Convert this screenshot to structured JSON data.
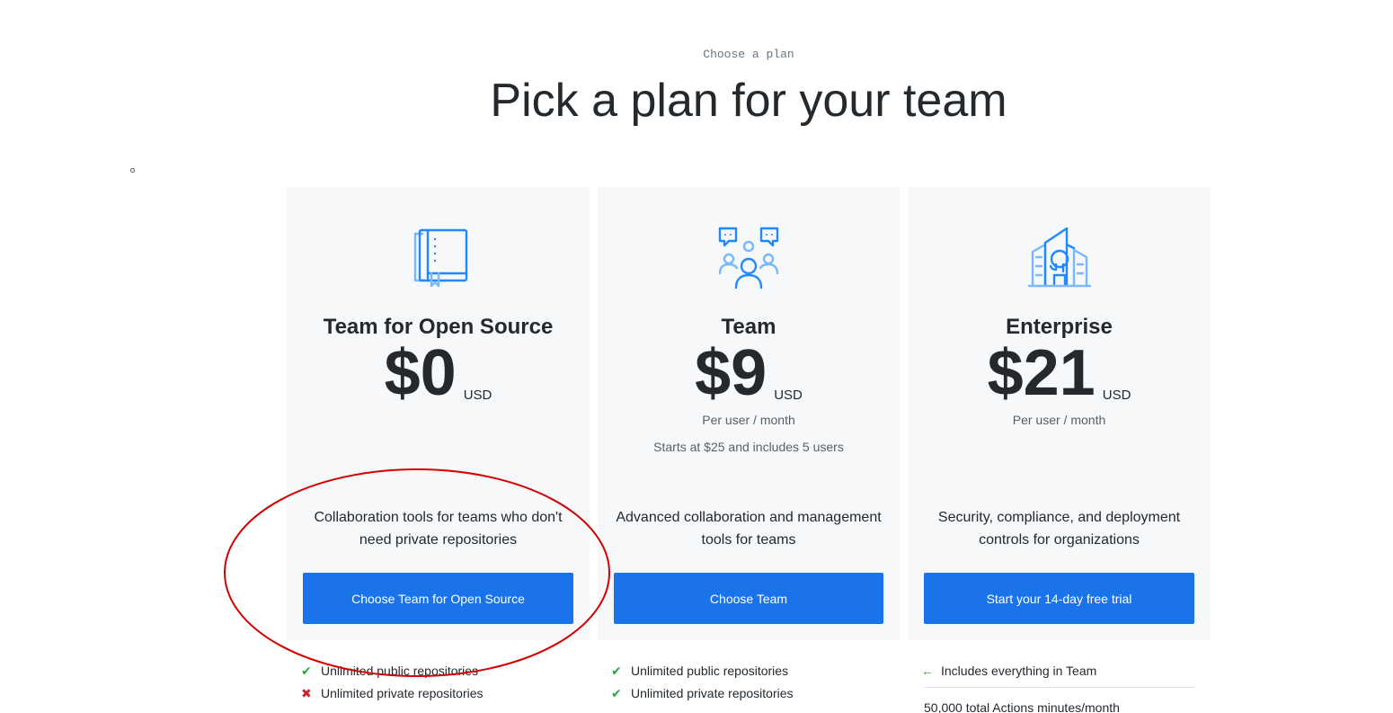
{
  "page": {
    "eyebrow": "Choose a plan",
    "headline": "Pick a plan for your team"
  },
  "plans": [
    {
      "icon": "book-icon",
      "title": "Team for Open Source",
      "price": "$0",
      "currency": "USD",
      "description": "Collaboration tools for teams who don't need private repositories",
      "cta": "Choose Team for Open Source",
      "features": [
        {
          "mark": "check",
          "text": "Unlimited public repositories"
        },
        {
          "mark": "cross",
          "text": "Unlimited private repositories"
        }
      ]
    },
    {
      "icon": "team-people-icon",
      "title": "Team",
      "price": "$9",
      "currency": "USD",
      "per": "Per user / month",
      "note": "Starts at $25 and includes 5 users",
      "description": "Advanced collaboration and management tools for teams",
      "cta": "Choose Team",
      "features": [
        {
          "mark": "check",
          "text": "Unlimited public repositories"
        },
        {
          "mark": "check",
          "text": "Unlimited private repositories"
        }
      ]
    },
    {
      "icon": "enterprise-building-icon",
      "title": "Enterprise",
      "price": "$21",
      "currency": "USD",
      "per": "Per user / month",
      "description": "Security, compliance, and deployment controls for organizations",
      "cta": "Start your 14-day free trial",
      "features": [
        {
          "mark": "arrow",
          "text": "Includes everything in Team"
        }
      ],
      "cut_off_text": "50,000 total Actions minutes/month"
    }
  ],
  "colors": {
    "accent": "#1a73e8",
    "card_bg": "#f6f8fa",
    "check": "#28a745",
    "cross": "#cb2431",
    "annotation": "#d40000"
  }
}
